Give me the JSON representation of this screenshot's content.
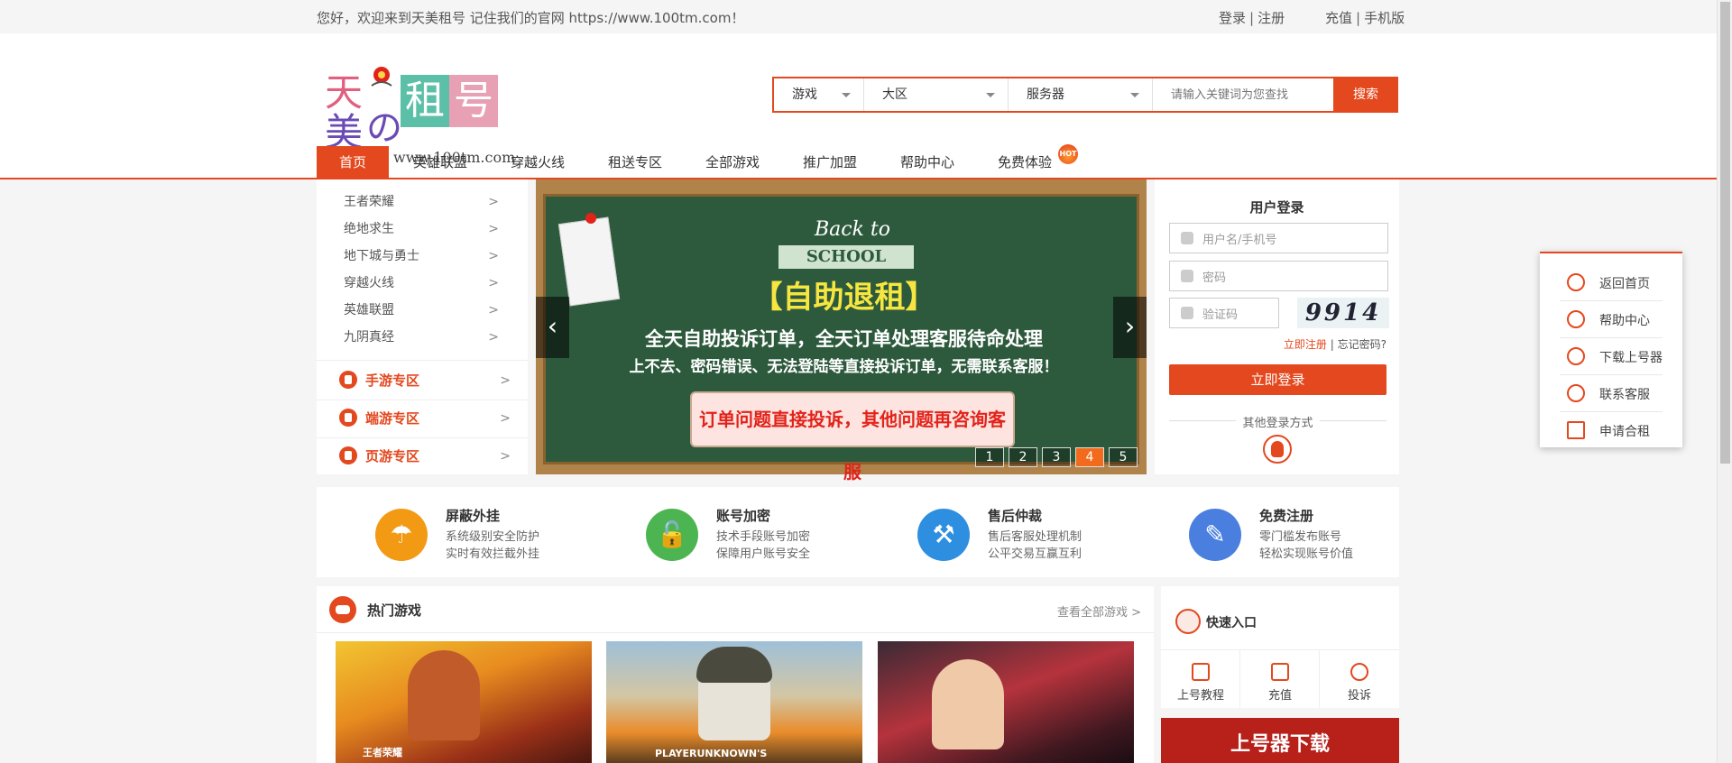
{
  "topbar": {
    "welcome": "您好，欢迎来到天美租号 记住我们的官网 https://www.100tm.com！",
    "login": "登录",
    "register": "注册",
    "charge": "充值",
    "mobile": "手机版",
    "separator": "|"
  },
  "logo": {
    "char_tian": "天",
    "char_mei": "美",
    "char_no": "の",
    "char_zu": "租",
    "char_hao": "号",
    "url": "www.100tm.com"
  },
  "search": {
    "game": "游戏",
    "region": "大区",
    "server": "服务器",
    "placeholder": "请输入关键词为您查找",
    "button": "搜索"
  },
  "nav": {
    "items": [
      "首页",
      "英雄联盟",
      "穿越火线",
      "租送专区",
      "全部游戏",
      "推广加盟",
      "帮助中心",
      "免费体验"
    ],
    "hot": "HOT"
  },
  "leftmenu": {
    "games": [
      "王者荣耀",
      "绝地求生",
      "地下城与勇士",
      "穿越火线",
      "英雄联盟",
      "九阴真经"
    ],
    "zones": [
      "手游专区",
      "端游专区",
      "页游专区"
    ],
    "chevron": ">"
  },
  "banner": {
    "back_to": "Back to",
    "school": "SCHOOL",
    "title": "【自助退租】",
    "line1": "全天自助投诉订单，全天订单处理客服待命处理",
    "line2": "上不去、密码错误、无法登陆等直接投诉订单，无需联系客服！",
    "scroll_text": "订单问题直接投诉，其他问题再咨询客服",
    "prev": "‹",
    "next": "›",
    "pages": [
      "1",
      "2",
      "3",
      "4",
      "5"
    ],
    "active_page": 4
  },
  "login": {
    "title": "用户登录",
    "username_placeholder": "用户名/手机号",
    "password_placeholder": "密码",
    "captcha_placeholder": "验证码",
    "captcha_text": "9914",
    "register_now": "立即注册",
    "separator": "|",
    "forgot": "忘记密码?",
    "button": "立即登录",
    "other_methods": "其他登录方式"
  },
  "features": [
    {
      "title": "屏蔽外挂",
      "desc1": "系统级别安全防护",
      "desc2": "实时有效拦截外挂",
      "color": "#f39a14",
      "icon": "umbrella-icon"
    },
    {
      "title": "账号加密",
      "desc1": "技术手段账号加密",
      "desc2": "保障用户账号安全",
      "color": "#4cb552",
      "icon": "lock-icon"
    },
    {
      "title": "售后仲裁",
      "desc1": "售后客服处理机制",
      "desc2": "公平交易互赢互利",
      "color": "#2e8fe0",
      "icon": "gavel-icon"
    },
    {
      "title": "免费注册",
      "desc1": "零门槛发布账号",
      "desc2": "轻松实现账号价值",
      "color": "#4a7fe0",
      "icon": "pen-icon"
    }
  ],
  "hotgames": {
    "title": "热门游戏",
    "more": "查看全部游戏 >",
    "cards": [
      "王者荣耀",
      "PLAYERUNKNOWN'S",
      ""
    ]
  },
  "quick": {
    "title": "快速入口",
    "items": [
      "上号教程",
      "充值",
      "投诉"
    ]
  },
  "download_banner": "上号器下载",
  "sidefloat": {
    "items": [
      "返回首页",
      "帮助中心",
      "下载上号器",
      "联系客服",
      "申请合租"
    ]
  },
  "colors": {
    "accent": "#e4481e",
    "hot": "#e43a1e",
    "board": "#2d5a3d"
  }
}
